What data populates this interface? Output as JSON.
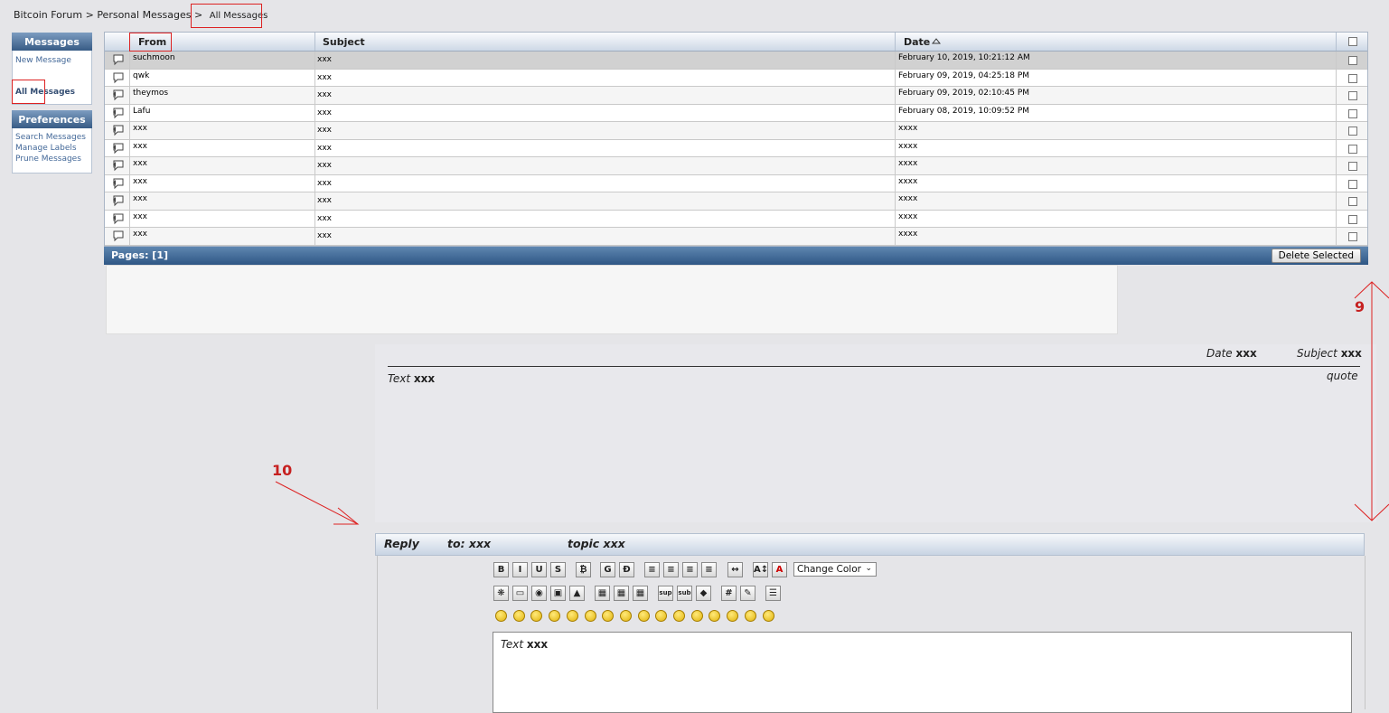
{
  "breadcrumb": {
    "forum": "Bitcoin Forum",
    "sep1": ">",
    "section": "Personal Messages",
    "sep2": ">",
    "current": "All Messages"
  },
  "sidebar": {
    "messages_header": "Messages",
    "new_message": "New Message",
    "all_messages": "All Messages",
    "preferences_header": "Preferences",
    "search_messages": "Search Messages",
    "manage_labels": "Manage Labels",
    "prune_messages": "Prune Messages"
  },
  "table": {
    "headers": {
      "from": "From",
      "subject": "Subject",
      "date": "Date",
      "sort_icon": "sort-up-icon"
    },
    "rows": [
      {
        "icon": "message-icon",
        "from": "suchmoon",
        "subject": "xxx",
        "date": "February 10, 2019, 10:21:12 AM"
      },
      {
        "icon": "message-icon",
        "from": "qwk",
        "subject": "xxx",
        "date": "February 09, 2019, 04:25:18 PM"
      },
      {
        "icon": "replied-icon",
        "from": "theymos",
        "subject": "xxx",
        "date": "February 09, 2019, 02:10:45 PM"
      },
      {
        "icon": "replied-icon",
        "from": "Lafu",
        "subject": "xxx",
        "date": "February 08, 2019, 10:09:52 PM"
      },
      {
        "icon": "replied-icon",
        "from": "xxx",
        "subject": "xxx",
        "date": "xxxx"
      },
      {
        "icon": "replied-icon",
        "from": "xxx",
        "subject": "xxx",
        "date": "xxxx"
      },
      {
        "icon": "replied-icon",
        "from": "xxx",
        "subject": "xxx",
        "date": "xxxx"
      },
      {
        "icon": "replied-icon",
        "from": "xxx",
        "subject": "xxx",
        "date": "xxxx"
      },
      {
        "icon": "replied-icon",
        "from": "xxx",
        "subject": "xxx",
        "date": "xxxx"
      },
      {
        "icon": "replied-icon",
        "from": "xxx",
        "subject": "xxx",
        "date": "xxxx"
      },
      {
        "icon": "message-icon",
        "from": "xxx",
        "subject": "xxx",
        "date": "xxxx"
      }
    ],
    "pages": "Pages: [1]",
    "delete_selected": "Delete Selected"
  },
  "preview": {
    "date_label": "Date",
    "date_value": "xxx",
    "subject_label": "Subject",
    "subject_value": "xxx",
    "text_label": "Text",
    "text_value": "xxx",
    "quote": "quote"
  },
  "reply": {
    "title": "Reply",
    "to": "to: xxx",
    "topic": "topic xxx",
    "change_color": "Change Color",
    "text_label": "Text",
    "text_value": "xxx",
    "toolbar_row1": [
      "B",
      "I",
      "U",
      "S",
      "₿",
      "G",
      "Ð",
      "≡",
      "≡",
      "≡",
      "≡",
      "↔",
      "A↕",
      "A"
    ],
    "toolbar_row2": [
      "❋",
      "▭",
      "◉",
      "▣",
      "▲",
      "▦",
      "▦",
      "▦",
      "sup",
      "sub",
      "◆",
      "#",
      "✎",
      "☰"
    ]
  },
  "annotations": {
    "label_9": "9",
    "label_10": "10"
  },
  "colors": {
    "header_blue": "#375b85",
    "annotation_red": "#d22"
  }
}
